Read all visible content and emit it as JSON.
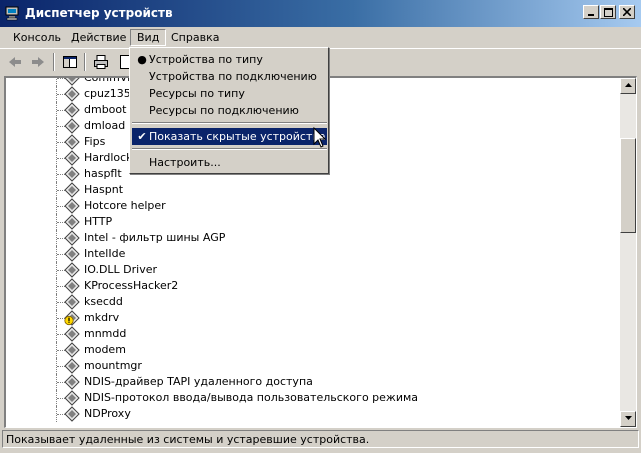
{
  "window": {
    "title": "Диспетчер устройств",
    "icon": "device-manager-icon"
  },
  "menubar": {
    "items": [
      "Консоль",
      "Действие",
      "Вид",
      "Справка"
    ]
  },
  "toolbar": {
    "icons": [
      "back-arrow-icon",
      "forward-arrow-icon",
      "show-hide-tree-icon",
      "print-icon",
      "properties-icon"
    ]
  },
  "view_menu": {
    "items": [
      {
        "label": "Устройства по типу",
        "mark": "bullet"
      },
      {
        "label": "Устройства по подключению",
        "mark": ""
      },
      {
        "label": "Ресурсы по типу",
        "mark": ""
      },
      {
        "label": "Ресурсы по подключению",
        "mark": ""
      },
      {
        "label": "Показать скрытые устройства",
        "mark": "check"
      },
      {
        "label": "Настроить...",
        "mark": ""
      }
    ]
  },
  "tree": {
    "items": [
      {
        "label": "CommView",
        "icon": "device-icon"
      },
      {
        "label": "cpuz135",
        "icon": "device-icon"
      },
      {
        "label": "dmboot",
        "icon": "device-icon"
      },
      {
        "label": "dmload",
        "icon": "device-icon"
      },
      {
        "label": "Fips",
        "icon": "device-icon"
      },
      {
        "label": "Hardlock",
        "icon": "device-icon"
      },
      {
        "label": "haspflt",
        "icon": "device-icon"
      },
      {
        "label": "Haspnt",
        "icon": "device-icon"
      },
      {
        "label": "Hotcore helper",
        "icon": "device-icon"
      },
      {
        "label": "HTTP",
        "icon": "device-icon"
      },
      {
        "label": "Intel - фильтр шины AGP",
        "icon": "device-icon"
      },
      {
        "label": "IntelIde",
        "icon": "device-icon"
      },
      {
        "label": "IO.DLL Driver",
        "icon": "device-icon"
      },
      {
        "label": "KProcessHacker2",
        "icon": "device-icon"
      },
      {
        "label": "ksecdd",
        "icon": "device-icon"
      },
      {
        "label": "mkdrv",
        "icon": "warning-device-icon"
      },
      {
        "label": "mnmdd",
        "icon": "device-icon"
      },
      {
        "label": "modem",
        "icon": "device-icon"
      },
      {
        "label": "mountmgr",
        "icon": "device-icon"
      },
      {
        "label": "NDIS-драйвер TAPI удаленного доступа",
        "icon": "device-icon"
      },
      {
        "label": "NDIS-протокол ввода/вывода пользовательского режима",
        "icon": "device-icon"
      },
      {
        "label": "NDProxy",
        "icon": "device-icon"
      }
    ]
  },
  "statusbar": {
    "text": "Показывает удаленные из системы и устаревшие устройства."
  }
}
